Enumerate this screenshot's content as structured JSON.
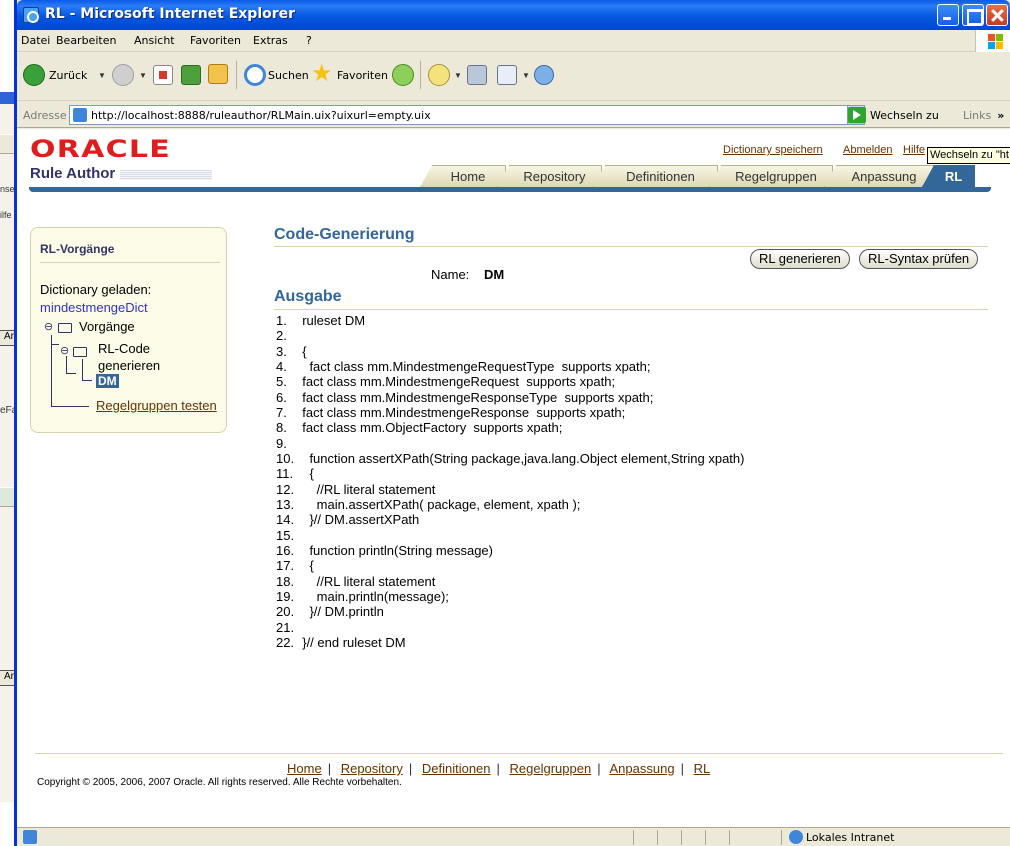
{
  "window": {
    "title": "RL - Microsoft Internet Explorer"
  },
  "menu": [
    "Datei",
    "Bearbeiten",
    "Ansicht",
    "Favoriten",
    "Extras",
    "?"
  ],
  "toolbar": {
    "back": "Zurück",
    "search": "Suchen",
    "favorites": "Favoriten"
  },
  "address": {
    "label": "Adresse",
    "url": "http://localhost:8888/ruleauthor/RLMain.uix?uixurl=empty.uix",
    "go": "Wechseln zu",
    "links": "Links"
  },
  "tooltip": "Wechseln zu \"ht",
  "brand": {
    "logo": "ORACLE",
    "product": "Rule Author"
  },
  "global_links": {
    "save_dict": "Dictionary speichern",
    "logout": "Abmelden",
    "help": "Hilfe"
  },
  "tabs": [
    "Home",
    "Repository",
    "Definitionen",
    "Regelgruppen",
    "Anpassung",
    "RL"
  ],
  "active_tab": "RL",
  "sidebar": {
    "title": "RL-Vorgänge",
    "dict_label": "Dictionary geladen:",
    "dict_name": "mindestmengeDict",
    "tree_root": "Vorgänge",
    "tree_child_1": "RL-Code",
    "tree_child_2": "generieren",
    "tree_selected": "DM",
    "tree_link": "Regelgruppen testen"
  },
  "main": {
    "heading": "Code-Generierung",
    "btn_generate": "RL generieren",
    "btn_check": "RL-Syntax prüfen",
    "name_label": "Name:",
    "name_value": "DM",
    "output_heading": "Ausgabe"
  },
  "code_lines": [
    {
      "n": "1.",
      "t": "  ruleset DM"
    },
    {
      "n": "2.",
      "t": ""
    },
    {
      "n": "3.",
      "t": "  {"
    },
    {
      "n": "4.",
      "t": "    fact class mm.MindestmengeRequestType  supports xpath;"
    },
    {
      "n": "5.",
      "t": "  fact class mm.MindestmengeRequest  supports xpath;"
    },
    {
      "n": "6.",
      "t": "  fact class mm.MindestmengeResponseType  supports xpath;"
    },
    {
      "n": "7.",
      "t": "  fact class mm.MindestmengeResponse  supports xpath;"
    },
    {
      "n": "8.",
      "t": "  fact class mm.ObjectFactory  supports xpath;"
    },
    {
      "n": "9.",
      "t": ""
    },
    {
      "n": "10.",
      "t": "    function assertXPath(String package,java.lang.Object element,String xpath)"
    },
    {
      "n": "11.",
      "t": "    {"
    },
    {
      "n": "12.",
      "t": "      //RL literal statement"
    },
    {
      "n": "13.",
      "t": "      main.assertXPath( package, element, xpath );"
    },
    {
      "n": "14.",
      "t": "    }// DM.assertXPath"
    },
    {
      "n": "15.",
      "t": ""
    },
    {
      "n": "16.",
      "t": "    function println(String message)"
    },
    {
      "n": "17.",
      "t": "    {"
    },
    {
      "n": "18.",
      "t": "      //RL literal statement"
    },
    {
      "n": "19.",
      "t": "      main.println(message);"
    },
    {
      "n": "20.",
      "t": "    }// DM.println"
    },
    {
      "n": "21.",
      "t": ""
    },
    {
      "n": "22.",
      "t": "  }// end ruleset DM"
    }
  ],
  "footer": {
    "links": [
      "Home",
      "Repository",
      "Definitionen",
      "Regelgruppen",
      "Anpassung",
      "RL"
    ],
    "copyright": "Copyright © 2005, 2006, 2007 Oracle. All rights reserved. Alle Rechte vorbehalten."
  },
  "status": {
    "zone": "Lokales Intranet"
  },
  "background_fragments": [
    "nse",
    "ilfe",
    "Ar",
    "eFa",
    "Ar"
  ]
}
